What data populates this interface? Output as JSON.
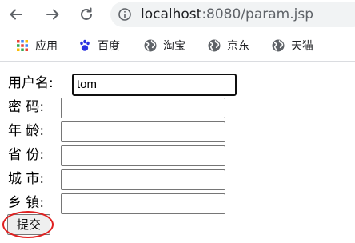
{
  "browser": {
    "url_host": "localhost",
    "url_rest": ":8080/param.jsp",
    "icons": {
      "back": "back-arrow-icon",
      "forward": "forward-arrow-icon",
      "reload": "reload-icon",
      "info": "info-icon"
    }
  },
  "bookmarks": [
    {
      "label": "应用",
      "icon": "apps-grid-icon"
    },
    {
      "label": "百度",
      "icon": "baidu-paw-icon"
    },
    {
      "label": "淘宝",
      "icon": "globe-icon"
    },
    {
      "label": "京东",
      "icon": "globe-icon"
    },
    {
      "label": "天猫",
      "icon": "globe-icon"
    }
  ],
  "form": {
    "username_label": "用户名:",
    "username_value": "tom",
    "password_label": "密 码:",
    "age_label": "年 龄:",
    "province_label": "省 份:",
    "city_label": "城 市:",
    "town_label": "乡 镇:",
    "submit_label": "提交"
  },
  "colors": {
    "highlight_circle": "#e02020",
    "omnibox_bg": "#f1f3f4"
  }
}
